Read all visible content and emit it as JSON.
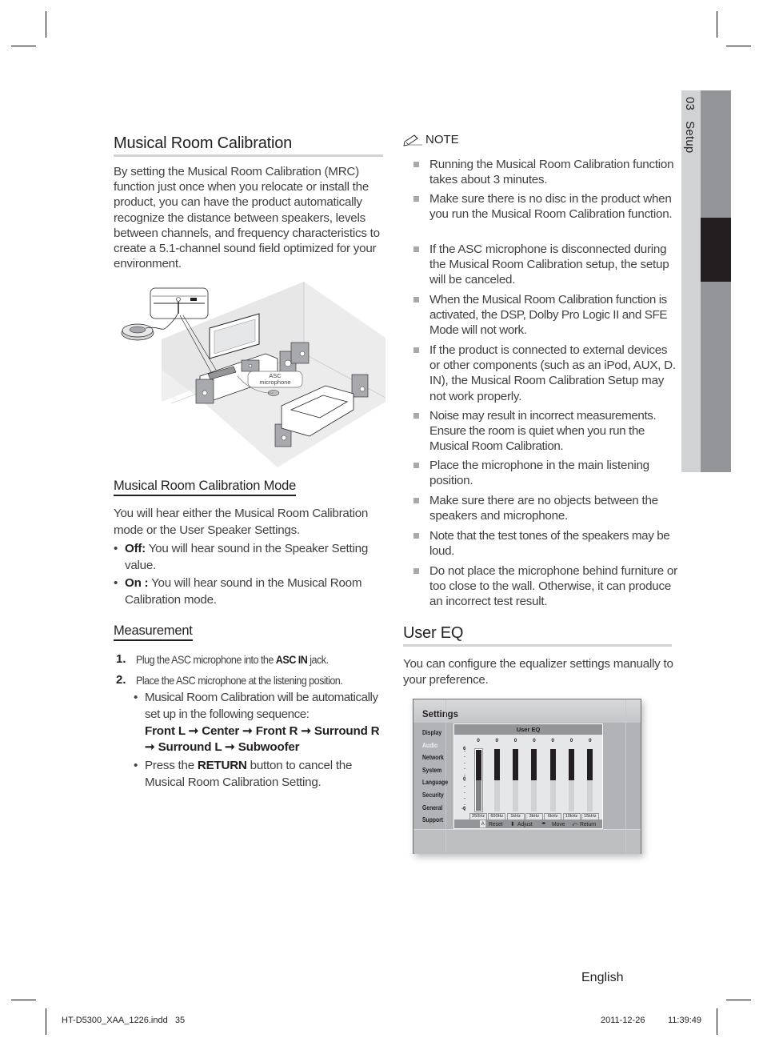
{
  "side_tab": {
    "chapter_number": "03",
    "chapter_title": "Setup"
  },
  "mrc": {
    "title": "Musical Room Calibration",
    "intro": "By setting the Musical Room Calibration (MRC) function just once when you relocate or install the product, you can have the product automatically recognize the distance between speakers, levels between channels, and frequency characteristics to create a 5.1-channel sound field optimized for your environment.",
    "diagram": {
      "callout_line1": "ASC",
      "callout_line2": "microphone"
    }
  },
  "mode": {
    "title": "Musical Room Calibration Mode",
    "intro": "You will hear either the Musical Room Calibration mode or the User Speaker Settings.",
    "items": [
      {
        "term": "Off:",
        "text": " You will hear sound in the Speaker Setting value."
      },
      {
        "term": "On :",
        "text": " You will hear sound in the Musical Room Calibration mode."
      }
    ]
  },
  "measurement": {
    "title": "Measurement",
    "steps": [
      {
        "num": "1.",
        "pre": "Plug the ASC microphone into the ",
        "bold": "ASC IN",
        "post": " jack."
      },
      {
        "num": "2.",
        "pre": "Place the ASC microphone at the listening position.",
        "bold": "",
        "post": ""
      }
    ],
    "sub_bullets": {
      "auto_text": "Musical Room Calibration will be automatically set up in the following sequence:",
      "sequence": [
        "Front L",
        "Center",
        "Front R",
        "Surround R",
        "Surround L",
        "Subwoofer"
      ],
      "arrow": "➞",
      "return_pre": "Press the ",
      "return_bold": "RETURN",
      "return_post": " button to cancel the Musical Room Calibration Setting."
    }
  },
  "note": {
    "label": "NOTE",
    "items": [
      "Running the Musical Room Calibration function takes about 3 minutes.",
      "Make sure there is no disc in the product when you run the Musical Room Calibration function.",
      "If the ASC microphone is disconnected during the Musical Room Calibration setup, the setup will be canceled.",
      "When the Musical Room Calibration function is activated, the DSP, Dolby Pro Logic II and SFE Mode will not work.",
      "If the product is connected to external devices or other components (such as an iPod, AUX, D. IN), the Musical Room Calibration Setup may not work properly.",
      "Noise may result in incorrect measurements. Ensure the room is quiet when you run the Musical Room Calibration.",
      "Place the microphone in the main listening position.",
      "Make sure there are no objects between the speakers and microphone.",
      "Note that the test tones of the speakers may be loud.",
      "Do not place the microphone behind furniture or too close to the wall. Otherwise, it can produce an incorrect test result."
    ]
  },
  "user_eq": {
    "title": "User EQ",
    "intro": "You can configure the equalizer settings manually to your preference.",
    "screen": {
      "title": "Settings",
      "menu": [
        "Display",
        "Audio",
        "Network",
        "System",
        "Language",
        "Security",
        "General",
        "Support"
      ],
      "active_menu": "Audio",
      "panel_title": "User EQ",
      "scale": {
        "max": "6",
        "mid": "0",
        "min": "-6"
      },
      "bands": [
        {
          "label": "250Hz",
          "value": 0,
          "value_text": "0",
          "selected": true
        },
        {
          "label": "600Hz",
          "value": 0,
          "value_text": "0",
          "selected": false
        },
        {
          "label": "1kHz",
          "value": 0,
          "value_text": "0",
          "selected": false
        },
        {
          "label": "3kHz",
          "value": 0,
          "value_text": "0",
          "selected": false
        },
        {
          "label": "6kHz",
          "value": 0,
          "value_text": "0",
          "selected": false
        },
        {
          "label": "10kHz",
          "value": 0,
          "value_text": "0",
          "selected": false
        },
        {
          "label": "15kHz",
          "value": 0,
          "value_text": "0",
          "selected": false
        }
      ],
      "hints": {
        "reset_key": "A",
        "reset": "Reset",
        "adjust_icon": "⬍",
        "adjust": "Adjust",
        "move_icon": "◂▸",
        "move": "Move",
        "return_icon": "⤺",
        "return": "Return"
      }
    }
  },
  "footer": {
    "language": "English",
    "slug_file": "HT-D5300_XAA_1226.indd   35",
    "slug_date": "2011-12-26",
    "slug_time": "11:39:49"
  }
}
